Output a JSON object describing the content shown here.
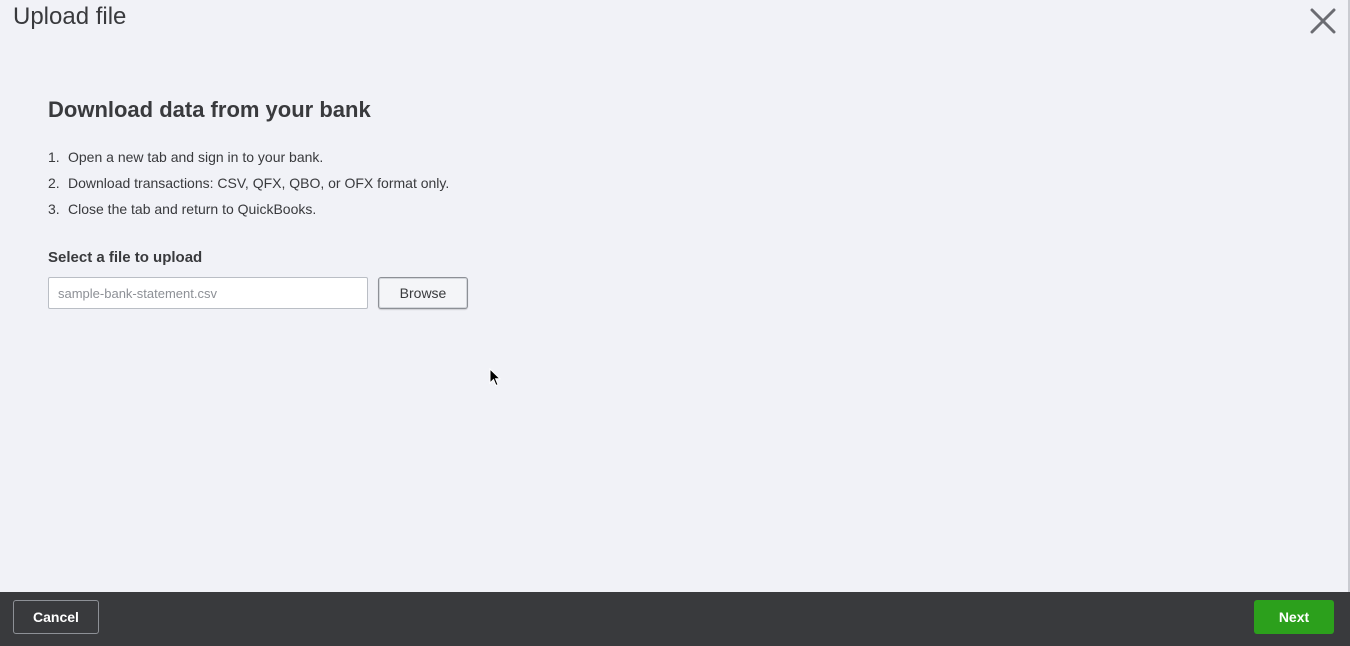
{
  "dialog": {
    "title": "Upload file"
  },
  "content": {
    "heading": "Download data from your bank",
    "steps": [
      {
        "num": "1.",
        "text": "Open a new tab and sign in to your bank."
      },
      {
        "num": "2.",
        "text": "Download transactions: CSV, QFX, QBO, or OFX format only."
      },
      {
        "num": "3.",
        "text": "Close the tab and return to QuickBooks."
      }
    ],
    "select_label": "Select a file to upload",
    "file_input": {
      "value": "",
      "placeholder": "sample-bank-statement.csv"
    },
    "browse_label": "Browse"
  },
  "footer": {
    "cancel_label": "Cancel",
    "next_label": "Next"
  },
  "icons": {
    "close": "close-icon",
    "cursor": "mouse-pointer-icon"
  },
  "colors": {
    "background": "#f1f2f7",
    "footer": "#393a3d",
    "primary": "#2ca01c",
    "text": "#393a3d"
  }
}
